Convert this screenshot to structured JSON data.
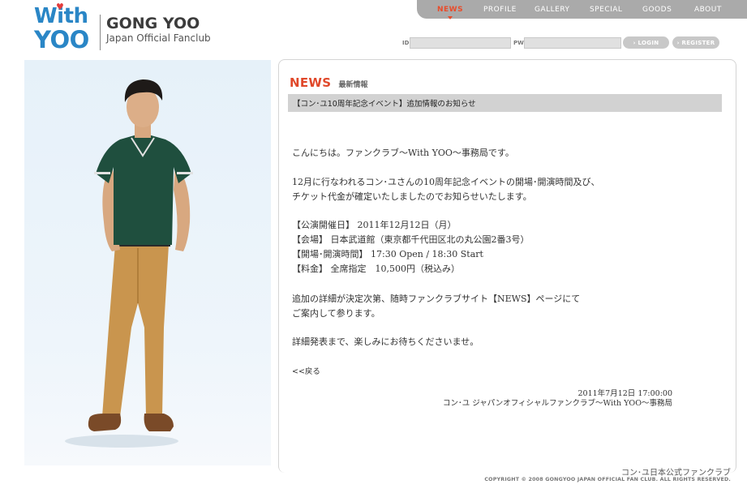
{
  "logo": {
    "with_text": "With",
    "yoo_text": "YOO",
    "name": "GONG YOO",
    "subtitle": "Japan Official Fanclub"
  },
  "nav": {
    "items": [
      "NEWS",
      "PROFILE",
      "GALLERY",
      "SPECIAL",
      "GOODS",
      "ABOUT"
    ],
    "active": "NEWS"
  },
  "login": {
    "id_label": "ID",
    "pw_label": "PW",
    "login_button": "LOGIN",
    "register_button": "REGISTER"
  },
  "section": {
    "title": "NEWS",
    "title_jp": "最新情報"
  },
  "article": {
    "heading": "【コン･ユ10周年記念イベント】追加情報のお知らせ",
    "greeting": "こんにちは。ファンクラブ～With YOO～事務局です。",
    "intro_lines": [
      "12月に行なわれるコン･ユさんの10周年記念イベントの開場･開演時間及び、",
      "チケット代金が確定いたしましたのでお知らせいたします。"
    ],
    "details": [
      "【公演開催日】 2011年12月12日（月）",
      "【会場】 日本武道館（東京都千代田区北の丸公園2番3号）",
      "【開場･開演時間】 17:30 Open / 18:30 Start",
      "【料金】 全席指定　10,500円（税込み）"
    ],
    "followup_lines": [
      "追加の詳細が決定次第、随時ファンクラブサイト【NEWS】ページにて",
      "ご案内して参ります。"
    ],
    "closing": "詳細発表まで、楽しみにお待ちくださいませ。",
    "back_link": "<<戻る",
    "date": "2011年7月12日 17:00:00",
    "signature": "コン･ユ ジャパンオフィシャルファンクラブ～With YOO～事務局"
  },
  "footer": {
    "jp": "コン･ユ日本公式ファンクラブ",
    "copyright": "COPYRIGHT © 2008 GONGYOO JAPAN OFFICIAL FAN CLUB. ALL RIGHTS RESERVED."
  },
  "colors": {
    "accent": "#e0482a",
    "logo_blue": "#2a86c6",
    "nav_bg": "#aaaaaa",
    "article_bar": "#d2d2d2"
  }
}
